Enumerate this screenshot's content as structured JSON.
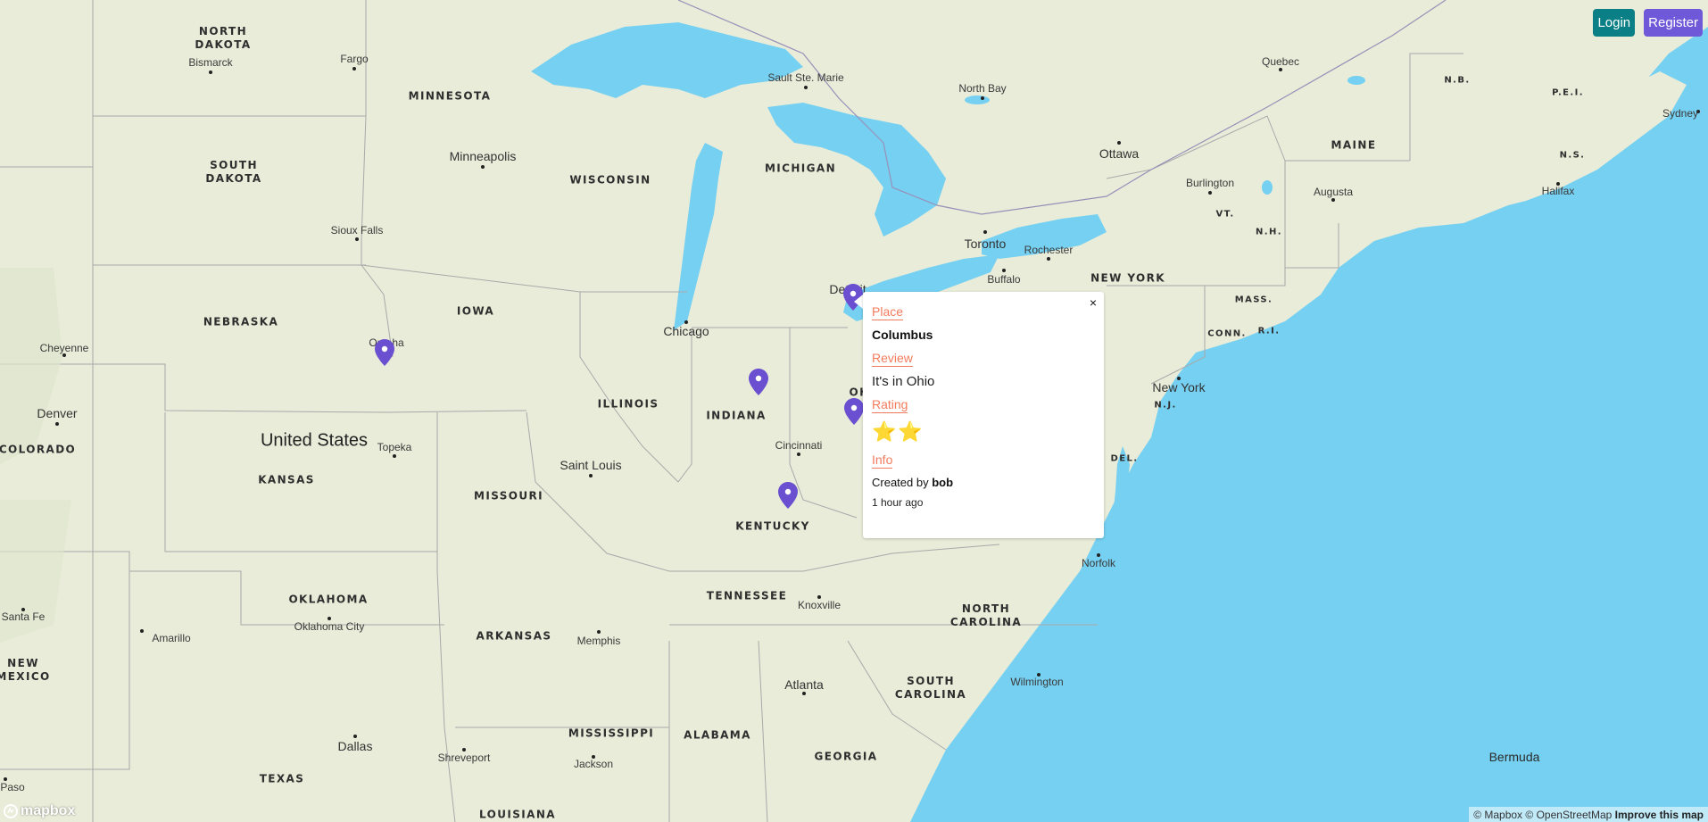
{
  "auth": {
    "login_label": "Login",
    "register_label": "Register"
  },
  "map": {
    "country_label": "United States",
    "ocean_label": "Bermuda",
    "states": [
      {
        "label": "NORTH\nDAKOTA"
      },
      {
        "label": "MINNESOTA"
      },
      {
        "label": "SOUTH\nDAKOTA"
      },
      {
        "label": "WISCONSIN"
      },
      {
        "label": "MICHIGAN"
      },
      {
        "label": "NEBRASKA"
      },
      {
        "label": "IOWA"
      },
      {
        "label": "ILLINOIS"
      },
      {
        "label": "INDIANA"
      },
      {
        "label": "OH"
      },
      {
        "label": "COLORADO"
      },
      {
        "label": "KANSAS"
      },
      {
        "label": "MISSOURI"
      },
      {
        "label": "KENTUCKY"
      },
      {
        "label": "TENNESSEE"
      },
      {
        "label": "OKLAHOMA"
      },
      {
        "label": "ARKANSAS"
      },
      {
        "label": "NORTH\nCAROLINA"
      },
      {
        "label": "SOUTH\nCAROLINA"
      },
      {
        "label": "NEW\nMEXICO"
      },
      {
        "label": "TEXAS"
      },
      {
        "label": "MISSISSIPPI"
      },
      {
        "label": "ALABAMA"
      },
      {
        "label": "GEORGIA"
      },
      {
        "label": "LOUISIANA"
      },
      {
        "label": "NEW YORK"
      },
      {
        "label": "MAINE"
      },
      {
        "label": "VT."
      },
      {
        "label": "N.H."
      },
      {
        "label": "MASS."
      },
      {
        "label": "CONN."
      },
      {
        "label": "R.I."
      },
      {
        "label": "N.J."
      },
      {
        "label": "DEL."
      },
      {
        "label": "N.B."
      },
      {
        "label": "P.E.I."
      },
      {
        "label": "N.S."
      }
    ],
    "cities": [
      {
        "label": "Bismarck"
      },
      {
        "label": "Fargo"
      },
      {
        "label": "Minneapolis"
      },
      {
        "label": "Sioux Falls"
      },
      {
        "label": "Sault Ste. Marie"
      },
      {
        "label": "North Bay"
      },
      {
        "label": "Ottawa"
      },
      {
        "label": "Quebec"
      },
      {
        "label": "Toronto"
      },
      {
        "label": "Rochester"
      },
      {
        "label": "Buffalo"
      },
      {
        "label": "Burlington"
      },
      {
        "label": "Augusta"
      },
      {
        "label": "Halifax"
      },
      {
        "label": "Sydney"
      },
      {
        "label": "Chicago"
      },
      {
        "label": "Detroit"
      },
      {
        "label": "Omaha"
      },
      {
        "label": "Cheyenne"
      },
      {
        "label": "Denver"
      },
      {
        "label": "Topeka"
      },
      {
        "label": "Saint Louis"
      },
      {
        "label": "Cincinnati"
      },
      {
        "label": "New York"
      },
      {
        "label": "Norfolk"
      },
      {
        "label": "Knoxville"
      },
      {
        "label": "Memphis"
      },
      {
        "label": "Oklahoma City"
      },
      {
        "label": "Amarillo"
      },
      {
        "label": "Santa Fe"
      },
      {
        "label": "Atlanta"
      },
      {
        "label": "Wilmington"
      },
      {
        "label": "Dallas"
      },
      {
        "label": "Shreveport"
      },
      {
        "label": "Jackson"
      },
      {
        "label": "Paso"
      }
    ]
  },
  "popup": {
    "place_heading": "Place",
    "place_name": "Columbus",
    "review_heading": "Review",
    "review_text": "It's in Ohio",
    "rating_heading": "Rating",
    "rating_stars": "⭐⭐",
    "rating_value": 2,
    "info_heading": "Info",
    "created_prefix": "Created by",
    "created_user": "bob",
    "time_ago": "1 hour ago",
    "close_symbol": "×"
  },
  "attribution": {
    "mapbox": "© Mapbox",
    "osm": "© OpenStreetMap",
    "improve": "Improve this map"
  },
  "logo": {
    "text": "mapbox"
  },
  "colors": {
    "land": "#e8ecd9",
    "water": "#76d0f1",
    "marker": "#6a4fd0",
    "login": "#0a7f86",
    "register": "#7059d8",
    "accent": "#f47b5c",
    "star": "#f5c518"
  }
}
